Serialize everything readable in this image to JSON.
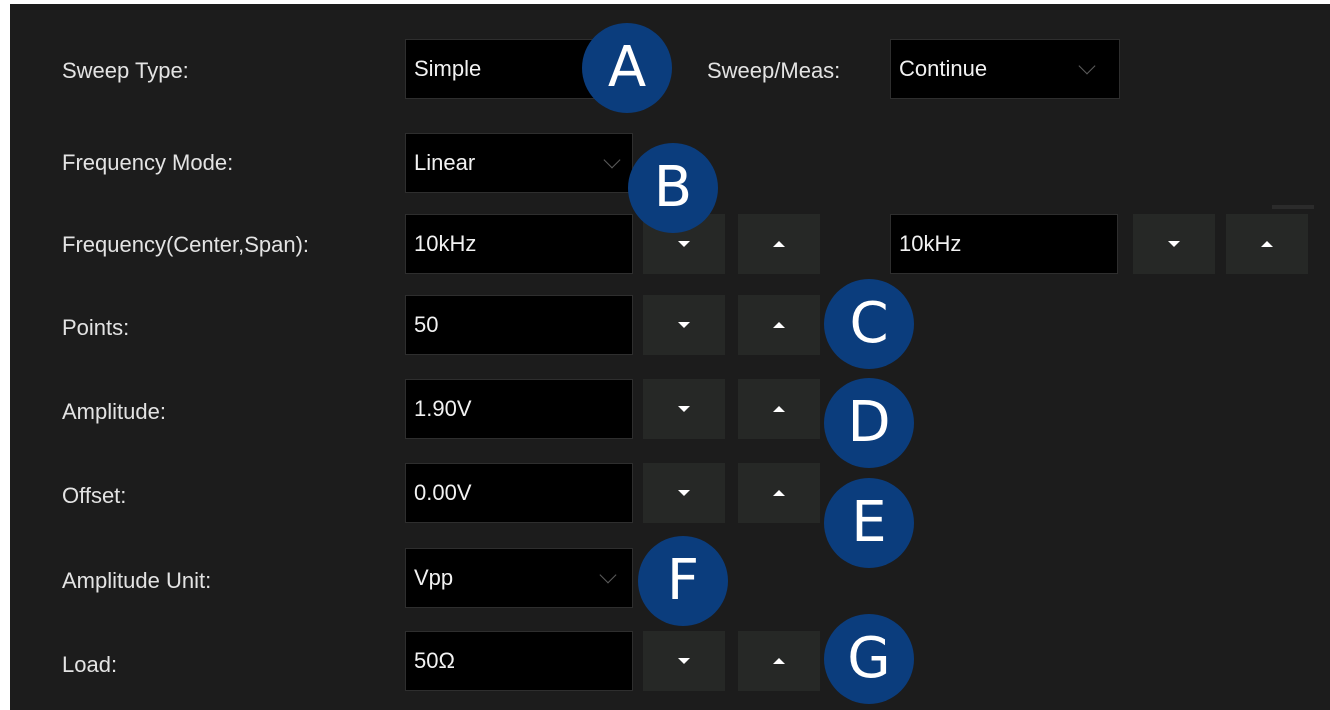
{
  "colors": {
    "panel_bg": "#1c1c1c",
    "field_bg": "#000000",
    "stepper_bg": "#262826",
    "badge_bg": "#0b3d7d",
    "label_text": "#e3e3e3",
    "value_text": "#f2f2f2"
  },
  "sweep_type": {
    "label": "Sweep Type:",
    "value": "Simple"
  },
  "sweep_meas": {
    "label": "Sweep/Meas:",
    "value": "Continue"
  },
  "frequency_mode": {
    "label": "Frequency Mode:",
    "value": "Linear"
  },
  "frequency": {
    "label": "Frequency(Center,Span):",
    "center": "10kHz",
    "span": "10kHz"
  },
  "points": {
    "label": "Points:",
    "value": "50"
  },
  "amplitude": {
    "label": "Amplitude:",
    "value": "1.90V"
  },
  "offset": {
    "label": "Offset:",
    "value": "0.00V"
  },
  "amplitude_unit": {
    "label": "Amplitude Unit:",
    "value": "Vpp"
  },
  "load": {
    "label": "Load:",
    "value": "50Ω"
  },
  "callouts": [
    "A",
    "B",
    "C",
    "D",
    "E",
    "F",
    "G"
  ],
  "icons": {
    "dropdown": "chevron-down-icon",
    "decrement": "triangle-down-icon",
    "increment": "triangle-up-icon"
  }
}
